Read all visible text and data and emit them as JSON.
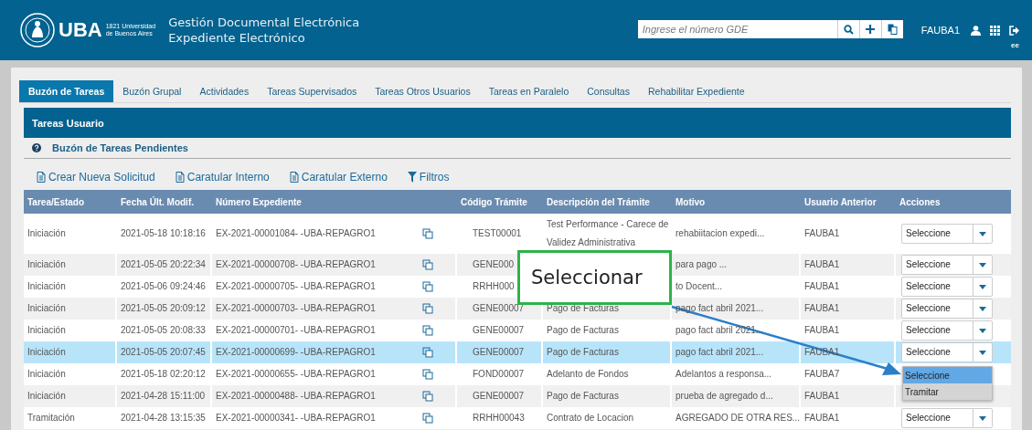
{
  "header": {
    "logo_text": "UBA",
    "logo_sub": [
      "1821 Universidad",
      "de Buenos Aires"
    ],
    "title": "Gestión Documental Electrónica",
    "subtitle": "Expediente Electrónico",
    "search": {
      "placeholder": "Ingrese el número GDE"
    },
    "user": "FAUBA1",
    "env": "ee"
  },
  "tabs": [
    {
      "label": "Buzón de Tareas",
      "selected": true
    },
    {
      "label": "Buzón Grupal",
      "selected": false
    },
    {
      "label": "Actividades",
      "selected": false
    },
    {
      "label": "Tareas Supervisados",
      "selected": false
    },
    {
      "label": "Tareas Otros Usuarios",
      "selected": false
    },
    {
      "label": "Tareas en Paralelo",
      "selected": false
    },
    {
      "label": "Consultas",
      "selected": false
    },
    {
      "label": "Rehabilitar Expediente",
      "selected": false
    }
  ],
  "panel_title": "Tareas Usuario",
  "section_title": "Buzón de Tareas Pendientes",
  "actions": [
    {
      "kind": "document",
      "label": "Crear Nueva Solicitud"
    },
    {
      "kind": "document",
      "label": "Caratular Interno"
    },
    {
      "kind": "document",
      "label": "Caratular Externo"
    },
    {
      "kind": "filter",
      "label": "Filtros"
    }
  ],
  "table": {
    "columns": [
      "Tarea/Estado",
      "Fecha Últ. Modif.",
      "Número Expediente",
      "",
      "Código Trámite",
      "Descripción del Trámite",
      "Motivo",
      "Usuario Anterior",
      "Acciones"
    ],
    "rows": [
      {
        "task": "Iniciación",
        "date": "2021-05-18 10:18:16",
        "number": "EX-2021-00001084- -UBA-REPAGRO1",
        "code": "TEST00001",
        "description": "Test Performance - Carece de Validez Administrativa",
        "reason": "rehabiitacion expedi...",
        "user": "FAUBA1",
        "action": "Seleccione",
        "selected": false
      },
      {
        "task": "Iniciación",
        "date": "2021-05-05 20:22:34",
        "number": "EX-2021-00000708- -UBA-REPAGRO1",
        "code": "GENE000",
        "reason": "para pago ...",
        "user": "FAUBA1",
        "action": "Seleccione",
        "selected": false
      },
      {
        "task": "Iniciación",
        "date": "2021-05-06 09:24:46",
        "number": "EX-2021-00000705- -UBA-REPAGRO1",
        "code": "RRHH000",
        "reason": "to Docent...",
        "user": "FAUBA1",
        "action": "Seleccione",
        "selected": false
      },
      {
        "task": "Iniciación",
        "date": "2021-05-05 20:09:12",
        "number": "EX-2021-00000703- -UBA-REPAGRO1",
        "code": "GENE00007",
        "description": "Pago de Facturas",
        "reason": "pago fact abril 2021...",
        "user": "FAUBA1",
        "action": "Seleccione",
        "selected": false
      },
      {
        "task": "Iniciación",
        "date": "2021-05-05 20:08:33",
        "number": "EX-2021-00000701- -UBA-REPAGRO1",
        "code": "GENE00007",
        "description": "Pago de Facturas",
        "reason": "pago fact abril 2021...",
        "user": "FAUBA1",
        "action": "Seleccione",
        "selected": false
      },
      {
        "task": "Iniciación",
        "date": "2021-05-05 20:07:45",
        "number": "EX-2021-00000699- -UBA-REPAGRO1",
        "code": "GENE00007",
        "description": "Pago de Facturas",
        "reason": "pago fact abril 2021...",
        "user": "FAUBA1",
        "action": "Seleccione",
        "selected": true
      },
      {
        "task": "Iniciación",
        "date": "2021-05-18 02:20:12",
        "number": "EX-2021-00000655- -UBA-REPAGRO1",
        "code": "FOND00007",
        "description": "Adelanto de Fondos",
        "reason": "Adelantos a responsa...",
        "user": "FAUBA7",
        "selected": false
      },
      {
        "task": "Iniciación",
        "date": "2021-04-28 15:11:00",
        "number": "EX-2021-00000488- -UBA-REPAGRO1",
        "code": "GENE00007",
        "description": "Pago de Facturas",
        "reason": "prueba de agregado d...",
        "user": "FAUBA1",
        "selected": false
      },
      {
        "task": "Tramitación",
        "date": "2021-04-28 13:15:35",
        "number": "EX-2021-00000341- -UBA-REPAGRO1",
        "code": "RRHH00043",
        "description": "Contrato de Locacion",
        "reason": "AGREGADO DE OTRA RES...",
        "user": "FAUBA1",
        "action": "Seleccione",
        "selected": false
      }
    ]
  },
  "dropdown": {
    "options": [
      {
        "label": "Seleccione",
        "selected": true
      },
      {
        "label": "Tramitar",
        "selected": false
      }
    ]
  },
  "callout": "Seleccionar"
}
